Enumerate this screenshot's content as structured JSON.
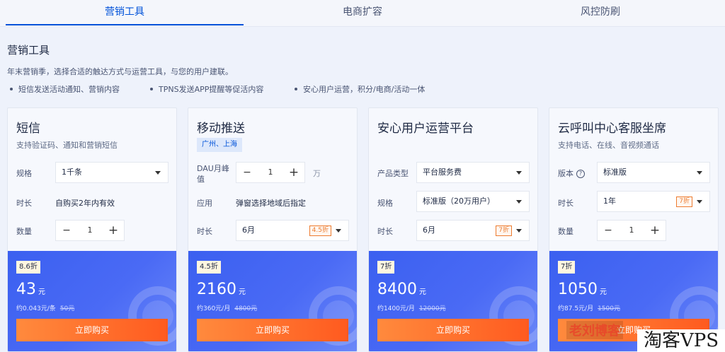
{
  "tabs": [
    {
      "label": "营销工具",
      "active": true
    },
    {
      "label": "电商扩容",
      "active": false
    },
    {
      "label": "风控防刷",
      "active": false
    }
  ],
  "section": {
    "title": "营销工具",
    "description": "年末营销季，选择合适的触达方式与运营工具，与您的用户建联。",
    "bullets": [
      "短信发送活动通知、营销内容",
      "TPNS发送APP提醒等促活内容",
      "安心用户运营，积分/电商/活动一体"
    ]
  },
  "cards": [
    {
      "title": "短信",
      "subtitle": "支持验证码、通知和营销短信",
      "spec_label": "规格",
      "spec_value": "1千条",
      "duration_label": "时长",
      "duration_value": "自购买2年内有效",
      "qty_label": "数量",
      "qty_minus": "−",
      "qty_value": "1",
      "qty_plus": "+",
      "badge": "8.6折",
      "price": "43",
      "currency": "元",
      "unit_price": "约0.043元/条",
      "original_price": "50元",
      "buy_label": "立即购买"
    },
    {
      "title": "移动推送",
      "region": "广州、上海",
      "dau_label": "DAU月峰值",
      "dau_minus": "−",
      "dau_value": "1",
      "dau_plus": "+",
      "dau_unit": "万",
      "app_label": "应用",
      "app_value": "弹窗选择地域后指定",
      "duration_label": "时长",
      "duration_value": "6月",
      "duration_discount": "4.5折",
      "badge": "4.5折",
      "price": "2160",
      "currency": "元",
      "unit_price": "约360元/月",
      "original_price": "4800元",
      "buy_label": "立即购买"
    },
    {
      "title": "安心用户运营平台",
      "type_label": "产品类型",
      "type_value": "平台服务费",
      "spec_label": "规格",
      "spec_value": "标准版（20万用户）",
      "duration_label": "时长",
      "duration_value": "6月",
      "duration_discount": "7折",
      "badge": "7折",
      "price": "8400",
      "currency": "元",
      "unit_price": "约1400元/月",
      "original_price": "12000元",
      "buy_label": "立即购买"
    },
    {
      "title": "云呼叫中心客服坐席",
      "subtitle": "支持电话、在线、音视频通话",
      "version_label": "版本",
      "version_value": "标准版",
      "duration_label": "时长",
      "duration_value": "1年",
      "duration_discount": "7折",
      "qty_label": "数量",
      "qty_minus": "−",
      "qty_value": "1",
      "qty_plus": "+",
      "badge": "7折",
      "price": "1050",
      "currency": "元",
      "unit_price": "约87.5元/月",
      "original_price": "1500元",
      "buy_label": "立即购买"
    }
  ],
  "overlay": {
    "watermark": "老刘博客",
    "brand": "淘客VPS"
  },
  "colors": {
    "accent": "#0052d9",
    "buy_button": "#ff6a2a",
    "price_panel": "#4a6af5",
    "discount": "#ed7b2f"
  }
}
